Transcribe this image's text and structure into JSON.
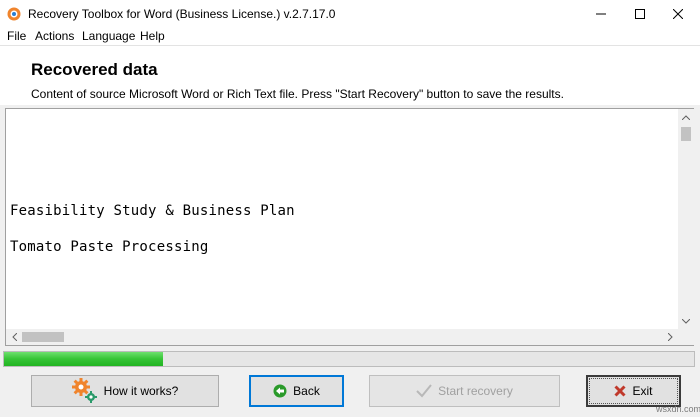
{
  "window": {
    "title": "Recovery Toolbox for Word (Business License.) v.2.7.17.0",
    "controls": [
      "minimize",
      "maximize",
      "close"
    ]
  },
  "menu": {
    "items": [
      "File",
      "Actions",
      "Language",
      "Help"
    ]
  },
  "header": {
    "title": "Recovered data",
    "subtitle": "Content of source Microsoft Word or Rich Text file. Press \"Start Recovery\" button to save the results."
  },
  "document": {
    "lines": [
      "Feasibility Study & Business Plan",
      "Tomato Paste Processing"
    ]
  },
  "progress": {
    "value": 0.23
  },
  "buttons": {
    "how_it_works": "How it works?",
    "back": "Back",
    "start_recovery": "Start recovery",
    "exit": "Exit"
  },
  "watermark": "wsxdn.com",
  "colors": {
    "progress": "#36c436",
    "back_icon": "#2a9a2a",
    "exit_icon": "#c0392b",
    "gear": "#f0842c"
  }
}
